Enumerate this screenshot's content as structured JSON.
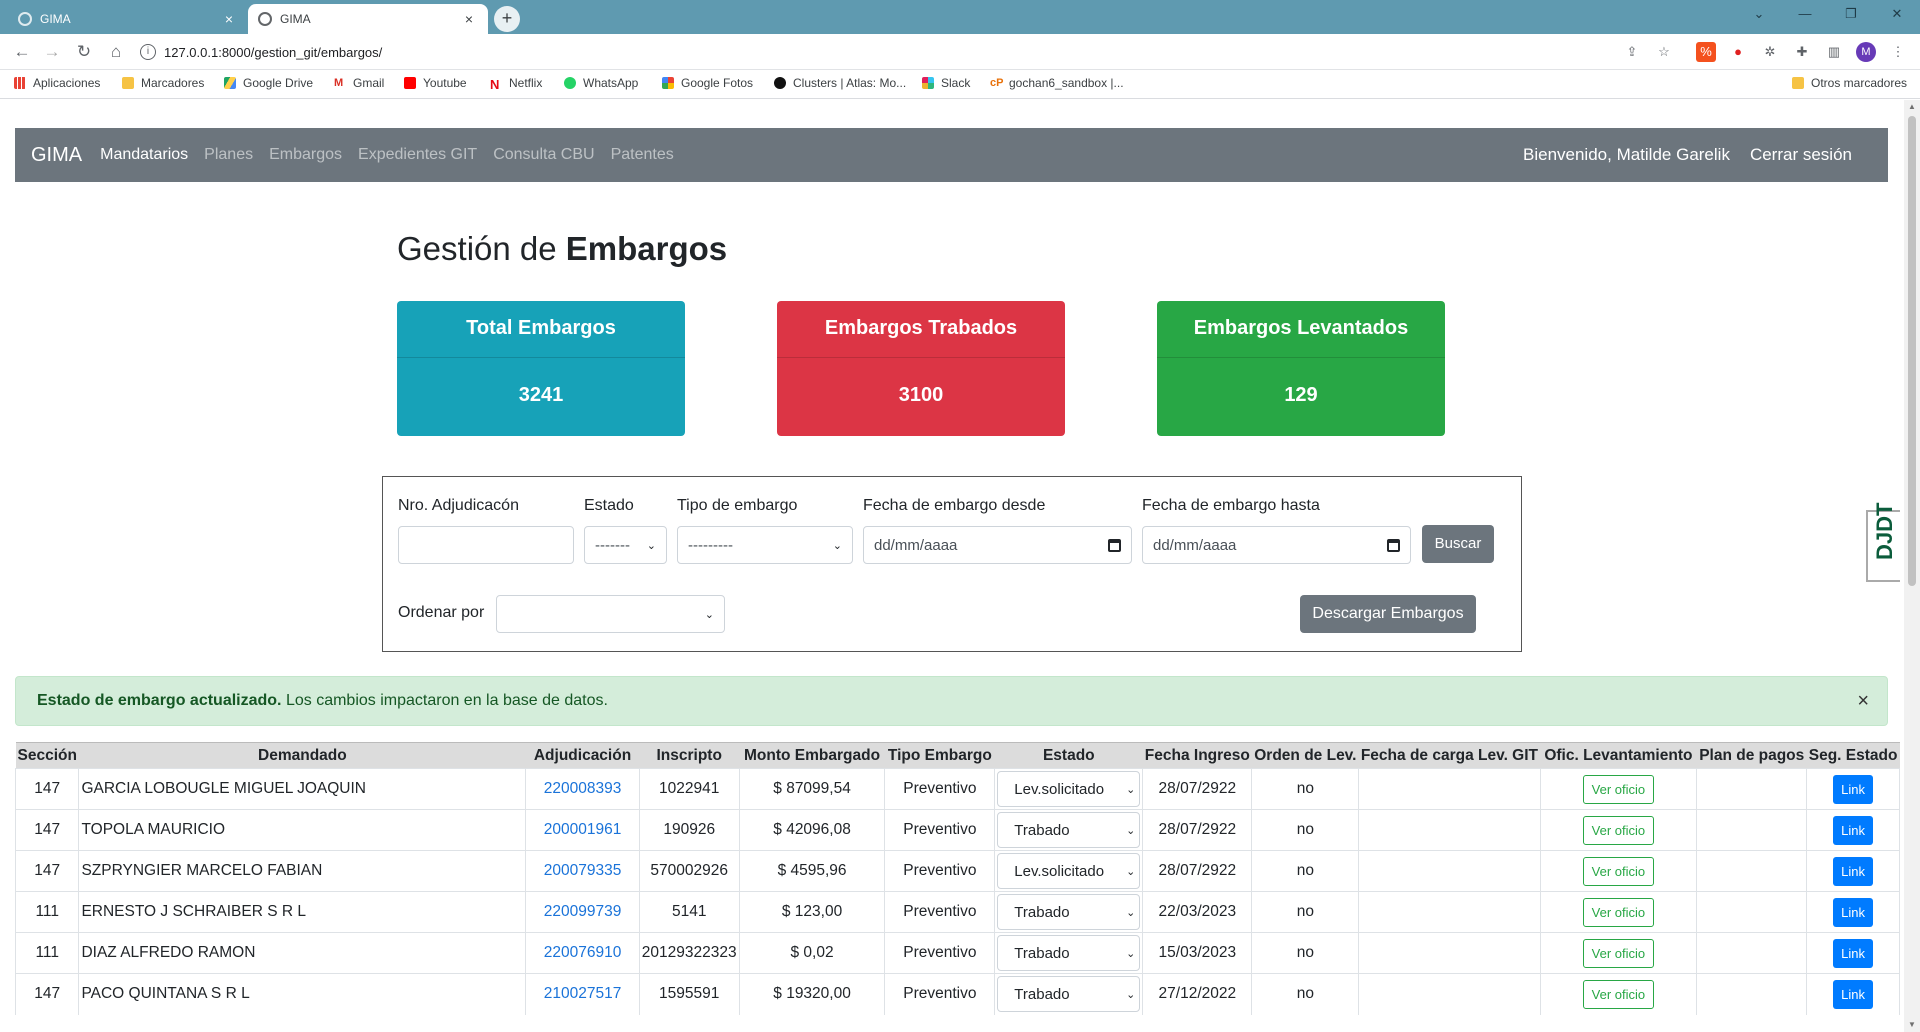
{
  "browser": {
    "tabs": [
      {
        "label": "GIMA",
        "close": "×"
      },
      {
        "label": "GIMA",
        "close": "×"
      }
    ],
    "new_tab": "+",
    "url": "127.0.0.1:8000/gestion_git/embargos/",
    "profile_initial": "M",
    "bookmarks": [
      "Aplicaciones",
      "Marcadores",
      "Google Drive",
      "Gmail",
      "Youtube",
      "Netflix",
      "WhatsApp",
      "Google Fotos",
      "Clusters | Atlas: Mo...",
      "Slack",
      "gochan6_sandbox |...",
      "Otros marcadores"
    ]
  },
  "nav": {
    "brand": "GIMA",
    "links": [
      "Mandatarios",
      "Planes",
      "Embargos",
      "Expedientes GIT",
      "Consulta CBU",
      "Patentes"
    ],
    "welcome": "Bienvenido, Matilde Garelik",
    "logout": "Cerrar sesión"
  },
  "page_title": {
    "prefix": "Gestión de",
    "bold": "Embargos"
  },
  "cards": [
    {
      "title": "Total Embargos",
      "value": "3241",
      "color": "#17a2b8"
    },
    {
      "title": "Embargos Trabados",
      "value": "3100",
      "color": "#dc3545"
    },
    {
      "title": "Embargos Levantados",
      "value": "129",
      "color": "#28a745"
    }
  ],
  "filters": {
    "nro_label": "Nro. Adjudicacón",
    "estado_label": "Estado",
    "estado_value": "-------",
    "tipo_label": "Tipo de embargo",
    "tipo_value": "---------",
    "desde_label": "Fecha de embargo desde",
    "desde_placeholder": "dd/mm/aaaa",
    "hasta_label": "Fecha de embargo hasta",
    "hasta_placeholder": "dd/mm/aaaa",
    "buscar": "Buscar",
    "ordenar_label": "Ordenar por",
    "descargar": "Descargar Embargos"
  },
  "alert": {
    "bold": "Estado de embargo actualizado.",
    "text": " Los cambios impactaron en la base de datos.",
    "close": "×"
  },
  "table": {
    "headers": [
      "Sección",
      "Demandado",
      "Adjudicación",
      "Inscripto",
      "Monto Embargado",
      "Tipo Embargo",
      "Estado",
      "Fecha Ingreso",
      "Orden de Lev.",
      "Fecha de carga Lev. GIT",
      "Ofic. Levantamiento",
      "Plan de pagos",
      "Seg. Estado"
    ],
    "rows": [
      {
        "seccion": "147",
        "demandado": "GARCIA LOBOUGLE MIGUEL JOAQUIN",
        "adj": "220008393",
        "inscripto": "1022941",
        "monto": "$ 87099,54",
        "tipo": "Preventivo",
        "estado": "Lev.solicitado",
        "fecha": "28/07/2922",
        "orden": "no",
        "oficio": "Ver oficio",
        "link": "Link"
      },
      {
        "seccion": "147",
        "demandado": "TOPOLA MAURICIO",
        "adj": "200001961",
        "inscripto": "190926",
        "monto": "$ 42096,08",
        "tipo": "Preventivo",
        "estado": "Trabado",
        "fecha": "28/07/2922",
        "orden": "no",
        "oficio": "Ver oficio",
        "link": "Link"
      },
      {
        "seccion": "147",
        "demandado": "SZPRYNGIER MARCELO FABIAN",
        "adj": "200079335",
        "inscripto": "570002926",
        "monto": "$ 4595,96",
        "tipo": "Preventivo",
        "estado": "Lev.solicitado",
        "fecha": "28/07/2922",
        "orden": "no",
        "oficio": "Ver oficio",
        "link": "Link"
      },
      {
        "seccion": "111",
        "demandado": "ERNESTO J SCHRAIBER S R L",
        "adj": "220099739",
        "inscripto": "5141",
        "monto": "$ 123,00",
        "tipo": "Preventivo",
        "estado": "Trabado",
        "fecha": "22/03/2023",
        "orden": "no",
        "oficio": "Ver oficio",
        "link": "Link"
      },
      {
        "seccion": "111",
        "demandado": "DIAZ ALFREDO RAMON",
        "adj": "220076910",
        "inscripto": "20129322323",
        "monto": "$ 0,02",
        "tipo": "Preventivo",
        "estado": "Trabado",
        "fecha": "15/03/2023",
        "orden": "no",
        "oficio": "Ver oficio",
        "link": "Link"
      },
      {
        "seccion": "147",
        "demandado": "PACO QUINTANA S R L",
        "adj": "210027517",
        "inscripto": "1595591",
        "monto": "$ 19320,00",
        "tipo": "Preventivo",
        "estado": "Trabado",
        "fecha": "27/12/2022",
        "orden": "no",
        "oficio": "Ver oficio",
        "link": "Link"
      }
    ]
  },
  "djdt_label": "DJDT"
}
